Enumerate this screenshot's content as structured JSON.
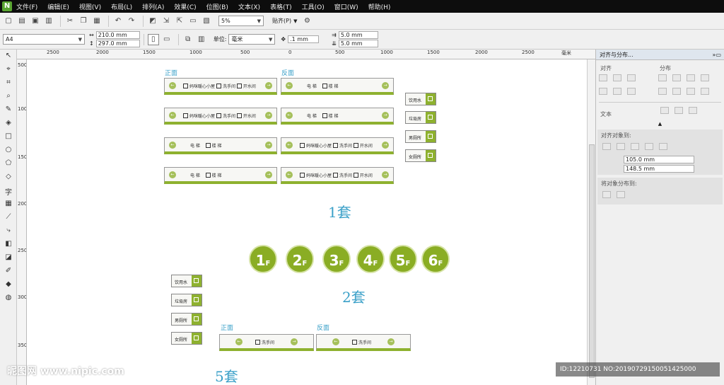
{
  "menu": [
    "文件(F)",
    "编辑(E)",
    "视图(V)",
    "布局(L)",
    "排列(A)",
    "效果(C)",
    "位图(B)",
    "文本(X)",
    "表格(T)",
    "工具(O)",
    "窗口(W)",
    "帮助(H)"
  ],
  "toolbar": {
    "zoom": "5%",
    "snap": "贴齐(P)"
  },
  "propbar": {
    "page_size": "A4",
    "width": "210.0 mm",
    "height": "297.0 mm",
    "unit_label": "单位:",
    "unit": "毫米",
    "nudge": ".1 mm",
    "dup_x": "5.0 mm",
    "dup_y": "5.0 mm"
  },
  "ruler_h": [
    "2500",
    "2000",
    "1500",
    "1000",
    "500",
    "0",
    "500",
    "1000",
    "1500",
    "2000",
    "2500"
  ],
  "ruler_h_unit": "毫米",
  "ruler_v": [
    "500",
    "1000",
    "1500",
    "2000",
    "2500",
    "3000",
    "3500"
  ],
  "panel": {
    "title": "对齐与分布...",
    "align": "对齐",
    "distribute": "分布",
    "text": "文本",
    "align_to": "对齐对象到:",
    "x": "105.0 mm",
    "y": "148.5 mm",
    "distribute_to": "将对象分布到:"
  },
  "canvas": {
    "front": "正面",
    "back": "反面",
    "set1": "1套",
    "set2": "2套",
    "set5": "5套",
    "signs": {
      "heart": "妈咪暖心小屋",
      "toilet": "洗手间",
      "water": "开水间",
      "elevator": "电 梯",
      "stairs": "楼 梯"
    },
    "tags": [
      "饮用水",
      "垃圾房",
      "男厕所",
      "女厕所"
    ],
    "floors": [
      "1",
      "2",
      "3",
      "4",
      "5",
      "6"
    ],
    "floor_suffix": "F",
    "toilet_big": "洗手间"
  },
  "watermark": "昵图网 www.nipic.com",
  "image_id": "ID:12210731 NO:20190729150051425000",
  "colors": {
    "accent": "#8aad24",
    "caption": "#3aa0c8"
  }
}
